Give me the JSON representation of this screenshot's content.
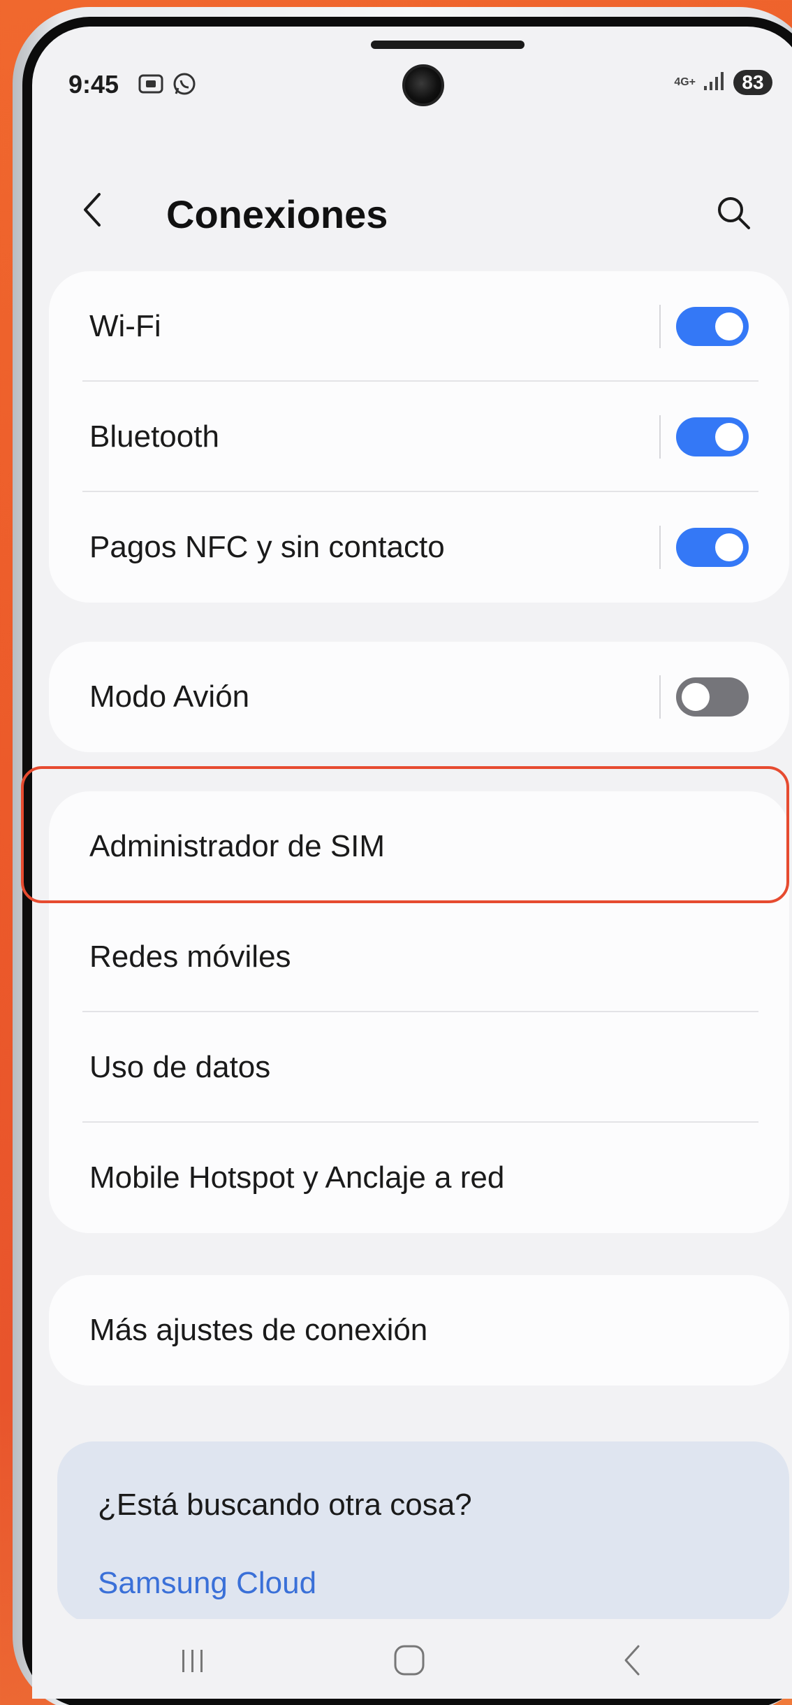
{
  "status_bar": {
    "time": "9:45",
    "network": "4G+",
    "battery": "83"
  },
  "header": {
    "title": "Conexiones"
  },
  "groups": [
    {
      "items": [
        {
          "label": "Wi-Fi",
          "toggle": true
        },
        {
          "label": "Bluetooth",
          "toggle": true
        },
        {
          "label": "Pagos NFC y sin contacto",
          "toggle": true
        }
      ]
    },
    {
      "items": [
        {
          "label": "Modo Avión",
          "toggle": false
        }
      ]
    },
    {
      "items": [
        {
          "label": "Administrador de SIM"
        },
        {
          "label": "Redes móviles"
        },
        {
          "label": "Uso de datos"
        },
        {
          "label": "Mobile Hotspot y Anclaje a red"
        }
      ]
    },
    {
      "items": [
        {
          "label": "Más ajustes de conexión"
        }
      ]
    }
  ],
  "suggestions": {
    "title": "¿Está buscando otra cosa?",
    "link": "Samsung Cloud"
  },
  "colors": {
    "toggle_on": "#3478f6",
    "toggle_off": "#75757a",
    "highlight": "#e64b30",
    "link": "#3a70d8"
  }
}
